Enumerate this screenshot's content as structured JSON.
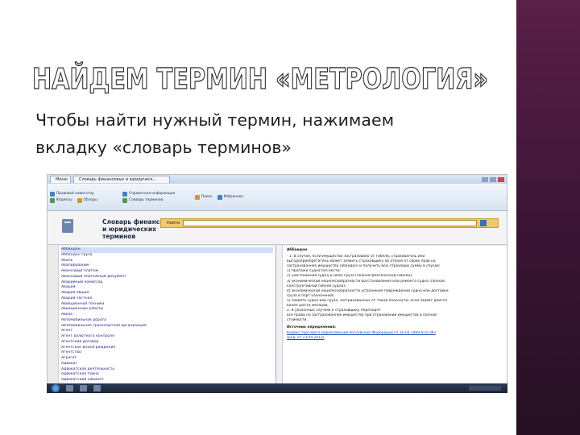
{
  "slide": {
    "title": "НАЙДЕМ ТЕРМИН «МЕТРОЛОГИЯ»",
    "body_line_1": "Чтобы найти нужный термин, нажимаем",
    "body_line_2": "вкладку «словарь терминов»",
    "accent_color": "#3c1535"
  },
  "app": {
    "tabs": [
      "Меню",
      "Словарь финансовых и юридическ..."
    ],
    "ribbon": [
      {
        "label": "Правовой навигатор",
        "icon": "compass-icon"
      },
      {
        "label": "Кодексы",
        "icon": "book-icon"
      },
      {
        "label": "Обзоры",
        "icon": "doc-icon"
      },
      {
        "label": "Справочная информация",
        "icon": "info-icon"
      },
      {
        "label": "Словарь терминов",
        "icon": "dictionary-icon"
      },
      {
        "label": "Поиск",
        "icon": "search-icon"
      },
      {
        "label": "Избранное",
        "icon": "star-icon"
      }
    ],
    "dictionary_title": "Словарь финансовых и юридических терминов",
    "search_label": "Найти"
  },
  "terms": [
    "Аббандон",
    "Аббандон груза",
    "Аваль",
    "Авалирование",
    "Авансовый платеж",
    "Авансовый платежный документ",
    "Аварийный комиссар",
    "Авария",
    "Авария общая",
    "Авария частная",
    "Авиационная техника",
    "Авиационные работы",
    "Авизо",
    "Автомобильная дорога",
    "Автомобильная транспортная организация",
    "Агент",
    "Агент валютного контроля",
    "Агентский договор",
    "Агентское вознаграждение",
    "Агентство",
    "Агрегат",
    "Адвокат",
    "Адвокатская деятельность",
    "Адвокатская тайна",
    "Адвокатский кабинет",
    "Адвокатское бюро"
  ],
  "definition": {
    "heading": "Аббандон",
    "lines": [
      "- 1. В случае, если имущество застраховано от гибели, страхователь или",
      "выгодоприобретатель может заявить страховщику об отказе от своих прав на",
      "застрахованное имущество (абандон) и получить всю страховую сумму в случае:",
      "1) пропажи судна без вести;",
      "2) уничтожения судна и (или) груза (полной фактической гибели);",
      "3) экономической нецелесообразности восстановления или ремонта судна (полной",
      "конструктивной гибели судна);",
      "4) экономической нецелесообразности устранения повреждений судна или доставки",
      "груза в порт назначения;",
      "5) захвата судна или груза, застрахованных от такой опасности, если захват длится",
      "более шести месяцев.",
      "2. В указанных случаях к страховщику переходят",
      "все права на застрахованное имущество при страховании имущества в полной",
      "стоимости."
    ],
    "source_heading": "Источник определения:",
    "sources": [
      "Кодекс торгового мореплавания Российской Федерации от 30.04.1999 N 81-ФЗ",
      "(ред. от 23.04.2012)"
    ]
  }
}
